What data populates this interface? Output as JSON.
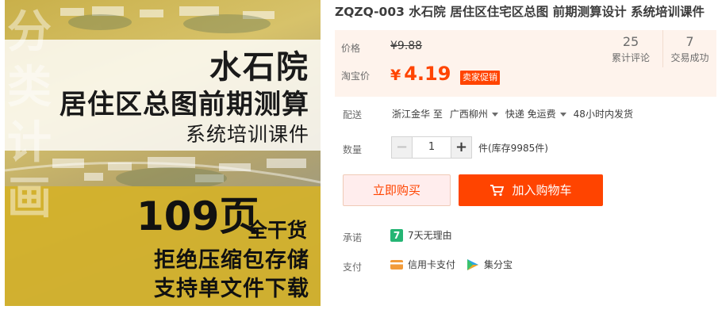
{
  "product_image": {
    "vertical_title": "分类计画",
    "title_line_1": "水石院",
    "title_line_2": "居住区总图前期测算",
    "title_line_3": "系统培训课件",
    "pages": "109页",
    "pages_suffix": "全干货",
    "line_2": "拒绝压缩包存储",
    "line_3": "支持单文件下载"
  },
  "product": {
    "title": "ZQZQ-003 水石院 居住区住宅区总图 前期测算设计 系统培训课件"
  },
  "price": {
    "label_original": "价格",
    "original_price": "¥9.88",
    "label_promo": "淘宝价",
    "currency": "¥",
    "promo_price": "4.19",
    "promo_badge": "卖家促销"
  },
  "stats": [
    {
      "num": "25",
      "label": "累计评论"
    },
    {
      "num": "7",
      "label": "交易成功"
    }
  ],
  "delivery": {
    "label": "配送",
    "from": "浙江金华 至",
    "to": "广西柳州",
    "method": "快递 免运费",
    "ship_time": "48小时内发货"
  },
  "quantity": {
    "label": "数量",
    "minus": "−",
    "value": "1",
    "plus": "+",
    "stock": "件(库存9985件)"
  },
  "actions": {
    "buy_now": "立即购买",
    "add_cart": "加入购物车"
  },
  "promise": {
    "label": "承诺",
    "icon_text": "7",
    "text": "7天无理由"
  },
  "payment": {
    "label": "支付",
    "items": [
      "信用卡支付",
      "集分宝"
    ]
  },
  "colors": {
    "accent": "#ff4400",
    "price_bg": "#fef3ec",
    "promise_green": "#25b574"
  }
}
